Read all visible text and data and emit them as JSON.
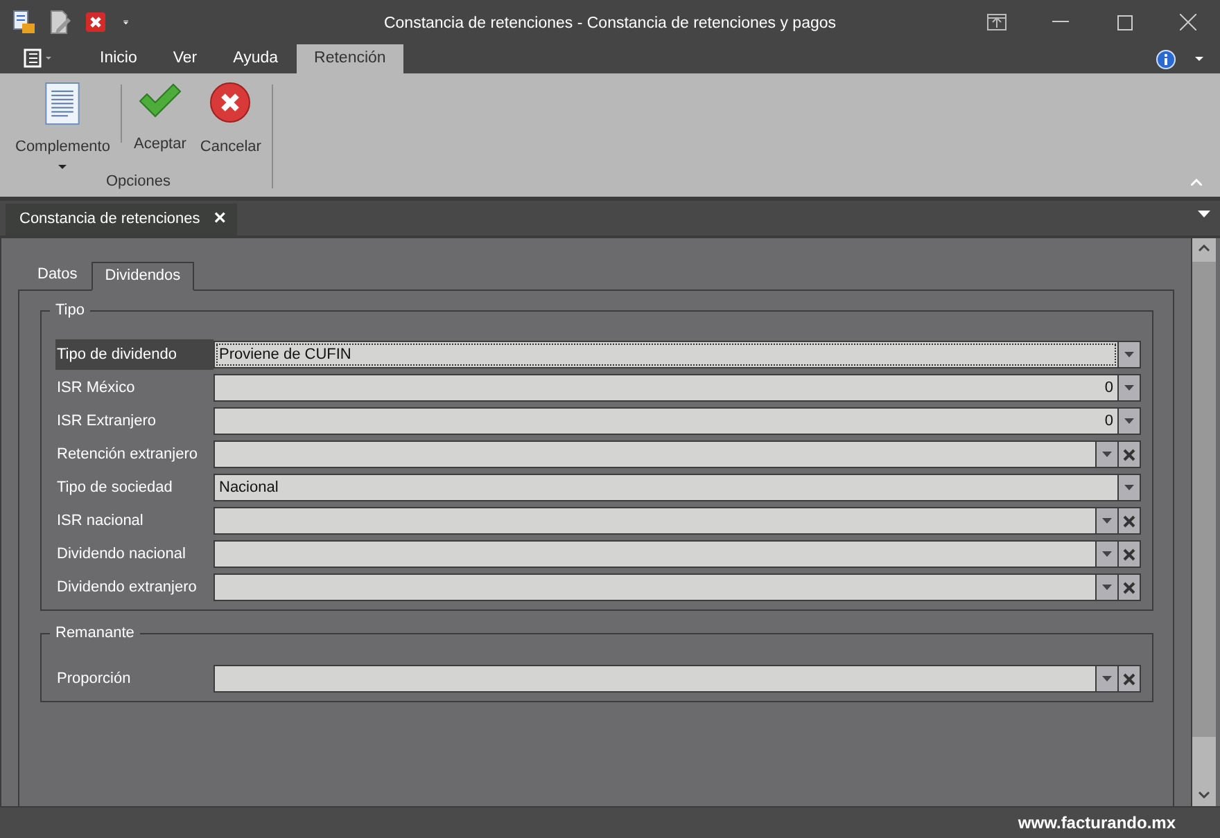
{
  "window": {
    "title": "Constancia de retenciones - Constancia de retenciones y pagos"
  },
  "ribbon_tabs": [
    {
      "label": "Inicio",
      "selected": false
    },
    {
      "label": "Ver",
      "selected": false
    },
    {
      "label": "Ayuda",
      "selected": false
    },
    {
      "label": "Retención",
      "selected": true
    }
  ],
  "ribbon_group": {
    "label": "Opciones",
    "buttons": [
      {
        "label": "Complemento",
        "kind": "document",
        "dropdown": true
      },
      {
        "label": "Aceptar",
        "kind": "accept",
        "dropdown": false
      },
      {
        "label": "Cancelar",
        "kind": "cancel",
        "dropdown": false
      }
    ]
  },
  "document_tab": {
    "label": "Constancia de retenciones",
    "close": "×"
  },
  "tabs": [
    {
      "label": "Datos",
      "selected": false
    },
    {
      "label": "Dividendos",
      "selected": true
    }
  ],
  "groups": [
    {
      "title": "Tipo",
      "fields": [
        {
          "label": "Tipo de dividendo",
          "kind": "combo",
          "value": "Proviene de CUFIN",
          "focused": true
        },
        {
          "label": "ISR México",
          "kind": "spin",
          "value": "0",
          "focused": false
        },
        {
          "label": "ISR Extranjero",
          "kind": "spin",
          "value": "0",
          "focused": false
        },
        {
          "label": "Retención extranjero",
          "kind": "clearable",
          "focused": false
        },
        {
          "label": "Tipo de sociedad",
          "kind": "combo",
          "value": "Nacional",
          "focused": false
        },
        {
          "label": "ISR nacional",
          "kind": "clearable",
          "focused": false
        },
        {
          "label": "Dividendo nacional",
          "kind": "clearable",
          "focused": false
        },
        {
          "label": "Dividendo extranjero",
          "kind": "clearable",
          "focused": false
        }
      ]
    },
    {
      "title": "Remanante",
      "fields": [
        {
          "label": "Proporción",
          "kind": "clearable",
          "focused": false
        }
      ]
    }
  ],
  "status_bar": {
    "text": "www.facturando.mx"
  }
}
